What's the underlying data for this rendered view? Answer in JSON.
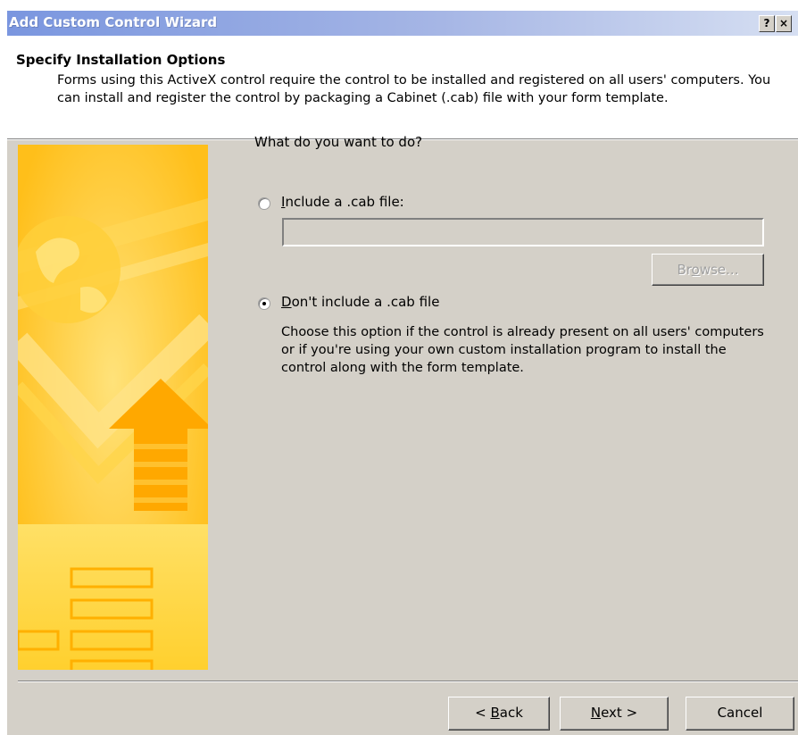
{
  "window": {
    "title": "Add Custom Control Wizard",
    "help_button": "?",
    "close_button": "×"
  },
  "header": {
    "heading": "Specify Installation Options",
    "description": "Forms using this ActiveX control require the control to be installed and registered on all users' computers. You can install and register the control by packaging a Cabinet (.cab) file with your form template."
  },
  "options": {
    "question": "What do you want to do?",
    "include_cab": {
      "prefix": "",
      "mnemonic": "I",
      "rest": "nclude a .cab file:",
      "selected": false,
      "path_value": "",
      "browse_mnemonic_prefix": "Br",
      "browse_mnemonic": "o",
      "browse_rest": "wse...",
      "browse_enabled": false
    },
    "dont_include_cab": {
      "mnemonic": "D",
      "rest": "on't include a .cab file",
      "selected": true,
      "description": "Choose this option if the control is already present on all users' computers or if you're using your own custom installation program to install the control along with the form template."
    }
  },
  "footer": {
    "back_prefix": "< ",
    "back_mnemonic": "B",
    "back_rest": "ack",
    "next_mnemonic": "N",
    "next_rest": "ext >",
    "cancel_label": "Cancel"
  },
  "colors": {
    "banner_yellow": "#ffc21e",
    "titlebar_blue": "#7a96df",
    "dialog_gray": "#d4d0c8"
  }
}
